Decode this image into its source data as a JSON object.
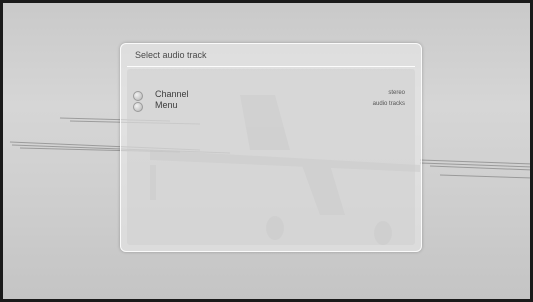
{
  "dialog": {
    "title": "Select audio track",
    "options": [
      {
        "label": "Channel",
        "value": "stereo"
      },
      {
        "label": "Menu",
        "value": "audio tracks"
      }
    ]
  },
  "colors": {
    "panel": "#e6e6e6",
    "text": "#3d3d3d",
    "background": "#cccccc"
  },
  "icons": {
    "radio": "radio-circle"
  }
}
